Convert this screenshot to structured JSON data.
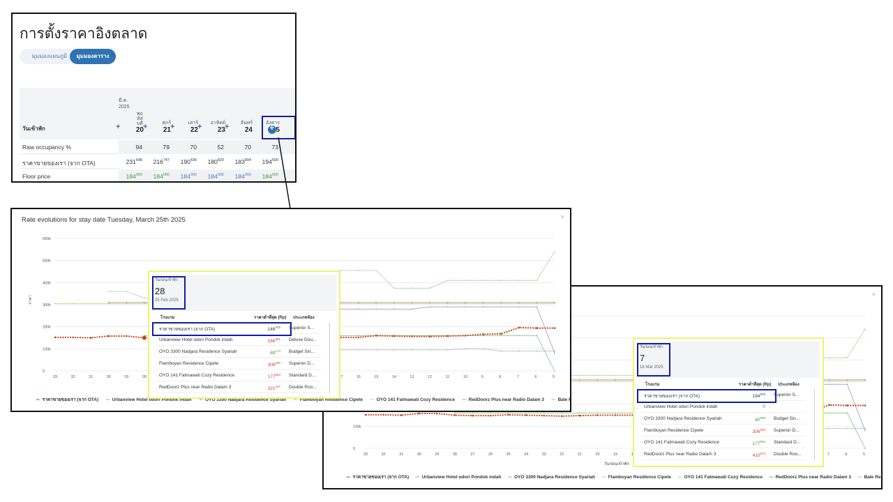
{
  "market": {
    "title": "การตั้งราคาอิงตลาด",
    "toggle_chart": "มุมมองแผนภูมิ",
    "toggle_table": "มุมมองตาราง",
    "month_label": "มี.ค.",
    "year_label": "2025",
    "row_header": "วันเข้าพัก",
    "days": [
      {
        "name": "พฤ หัส บดี",
        "num": "20"
      },
      {
        "name": "ศุกร์",
        "num": "21"
      },
      {
        "name": "เสาร์",
        "num": "22"
      },
      {
        "name": "อาทิตย์",
        "num": "23"
      },
      {
        "name": "จันทร์",
        "num": "24"
      },
      {
        "name": "อังคาร",
        "num": "25"
      }
    ],
    "rows": [
      {
        "label": "Raw occupancy %",
        "values": [
          {
            "m": "94",
            "s": ""
          },
          {
            "m": "79",
            "s": ""
          },
          {
            "m": "70",
            "s": ""
          },
          {
            "m": "52",
            "s": ""
          },
          {
            "m": "70",
            "s": ""
          },
          {
            "m": "73",
            "s": ""
          }
        ]
      },
      {
        "label": "ราคาขายของเรา (จาก OTA)",
        "values": [
          {
            "m": "231",
            "s": "648"
          },
          {
            "m": "216",
            "s": "747"
          },
          {
            "m": "190",
            "s": "436"
          },
          {
            "m": "180",
            "s": "820"
          },
          {
            "m": "183",
            "s": "804"
          },
          {
            "m": "194",
            "s": "509"
          }
        ]
      },
      {
        "label": "Floor price",
        "values": [
          {
            "m": "184",
            "s": "000"
          },
          {
            "m": "184",
            "s": "000"
          },
          {
            "m": "184",
            "s": "000"
          },
          {
            "m": "184",
            "s": "000"
          },
          {
            "m": "184",
            "s": "000"
          },
          {
            "m": "184",
            "s": "000"
          }
        ]
      }
    ],
    "floor_colors": [
      "#3a9b3a",
      "#3a9b3a",
      "#3d7fc2",
      "#3d7fc2",
      "#3d7fc2",
      "#3a9b3a"
    ]
  },
  "chart_panel": {
    "title": "Rate evolutions for stay date Tuesday, March 25th 2025",
    "close": "×",
    "y_axis_label": "ราคา",
    "x_axis_label": "วันก่อนเข้าพัก"
  },
  "chart_data": {
    "type": "line",
    "title": "Rate evolutions for stay date Tuesday, March 25th 2025",
    "xlabel": "วันก่อนเข้าพัก",
    "ylabel": "ราคา",
    "ylim": [
      0,
      600000
    ],
    "y_ticks": [
      "0",
      "100k",
      "200k",
      "300k",
      "400k",
      "500k",
      "600k"
    ],
    "x": [
      "33",
      "32",
      "31",
      "30",
      "29",
      "28",
      "27",
      "26",
      "25",
      "24",
      "23",
      "22",
      "21",
      "20",
      "19",
      "18",
      "17",
      "16",
      "15",
      "14",
      "13",
      "12",
      "11",
      "10",
      "9",
      "8",
      "7",
      "6",
      "5"
    ],
    "legend_position": "bottom",
    "series": [
      {
        "name": "ราคาขายของเรา (จาก OTA)",
        "color": "#c9461f",
        "values": [
          152000,
          152000,
          150000,
          158000,
          158000,
          150000,
          148000,
          148000,
          152000,
          150000,
          148000,
          146000,
          148000,
          150000,
          150000,
          150000,
          152000,
          152000,
          160000,
          158000,
          156000,
          156000,
          158000,
          160000,
          166000,
          168000,
          196000,
          194000,
          194000
        ]
      },
      {
        "name": "Urbanview Hotel odori Pondok indah",
        "color": "#7fc77f",
        "values": [
          null,
          null,
          null,
          null,
          null,
          160000,
          160000,
          160000,
          160000,
          160000,
          160000,
          160000,
          160000,
          160000,
          160000,
          160000,
          160000,
          160000,
          160000,
          160000,
          160000,
          160000,
          160000,
          160000,
          160000,
          160000,
          160000,
          160000,
          0
        ]
      },
      {
        "name": "OYO 3300 Nadjara Residence Syariah",
        "color": "#9a9ad8",
        "values": [
          null,
          null,
          null,
          null,
          null,
          null,
          null,
          null,
          null,
          null,
          null,
          null,
          null,
          null,
          null,
          null,
          280000,
          280000,
          280000,
          280000,
          280000,
          290000,
          290000,
          290000,
          290000,
          290000,
          290000,
          290000,
          80000
        ]
      },
      {
        "name": "Flamboyan Residence Cipete",
        "color": "#d6c27a",
        "values": [
          305000,
          305000,
          305000,
          305000,
          305000,
          305000,
          305000,
          305000,
          305000,
          305000,
          305000,
          305000,
          305000,
          305000,
          305000,
          305000,
          305000,
          305000,
          305000,
          305000,
          305000,
          305000,
          305000,
          305000,
          305000,
          305000,
          305000,
          305000,
          306000
        ]
      },
      {
        "name": "OYO 141 Fatmawati Cozy Residence",
        "color": "#a8d4a8",
        "values": [
          null,
          null,
          null,
          360000,
          360000,
          330000,
          330000,
          330000,
          330000,
          330000,
          330000,
          330000,
          330000,
          330000,
          330000,
          330000,
          455000,
          455000,
          455000,
          375000,
          375000,
          375000,
          410000,
          410000,
          410000,
          410000,
          410000,
          410000,
          540000
        ]
      },
      {
        "name": "RedDoorz Plus near Radio Dalam 3",
        "color": "#9a9a9a",
        "values": [
          null,
          null,
          null,
          310000,
          310000,
          310000,
          310000,
          310000,
          310000,
          310000,
          310000,
          310000,
          310000,
          310000,
          310000,
          310000,
          310000,
          310000,
          310000,
          310000,
          310000,
          310000,
          310000,
          310000,
          310000,
          310000,
          310000,
          310000,
          310000
        ]
      },
      {
        "name": "Bale Resident",
        "color": "#b5b5b5",
        "values": [
          null,
          null,
          null,
          null,
          null,
          null,
          null,
          null,
          null,
          null,
          null,
          null,
          null,
          null,
          null,
          null,
          95000,
          95000,
          95000,
          95000,
          95000,
          95000,
          95000,
          100000,
          100000,
          90000,
          90000,
          90000,
          90000
        ]
      }
    ]
  },
  "tooltip_a": {
    "k1": "วันก่อนเข้าพัก",
    "days_before": "28",
    "date": "25 Feb 2025",
    "col_hotel": "โรงแรม",
    "col_price": "ราคาต่ำที่สุด (Rp)",
    "col_room": "ประเภทห้อง",
    "rows": [
      {
        "name": "ราคาขายของเรา (จาก OTA)",
        "m": "146",
        "s": "472",
        "room": "Superior S...",
        "cls": ""
      },
      {
        "name": "Urbanview Hotel odori Pondok indah",
        "m": "166",
        "s": "381",
        "room": "Deluxe Dou...",
        "cls": "red"
      },
      {
        "name": "OYO 3300 Nadjara Residence Syariah",
        "m": "89",
        "s": "174",
        "room": "Budget Sin...",
        "cls": "grn"
      },
      {
        "name": "Flamboyan Residence Cipete",
        "m": "306",
        "s": "000",
        "room": "Superior D...",
        "cls": "red"
      },
      {
        "name": "OYO 141 Fatmawati Cozy Residence",
        "m": "177",
        "s": "064",
        "room": "Standard D...",
        "cls": "red"
      },
      {
        "name": "RedDoorz Plus near Radio Dalam 3",
        "m": "321",
        "s": "167",
        "room": "Double Roo...",
        "cls": "red"
      }
    ]
  },
  "tooltip_b": {
    "k1": "วันก่อนเข้าพัก",
    "days_before": "7",
    "date": "18 Mar 2025",
    "col_hotel": "โรงแรม",
    "col_price": "ราคาต่ำที่สุด (Rp)",
    "col_room": "ประเภทห้อง",
    "rows": [
      {
        "name": "ราคาขายของเรา (จาก OTA)",
        "m": "194",
        "s": "875",
        "room": "Superior S...",
        "cls": ""
      },
      {
        "name": "Urbanview Hotel odori Pondok indah",
        "m": "0",
        "s": "",
        "room": "",
        "cls": "grn"
      },
      {
        "name": "OYO 3300 Nadjara Residence Syariah",
        "m": "80",
        "s": "865",
        "room": "Budget Sin...",
        "cls": "grn"
      },
      {
        "name": "Flamboyan Residence Cipete",
        "m": "306",
        "s": "000",
        "room": "Superior D...",
        "cls": "red"
      },
      {
        "name": "OYO 141 Fatmawati Cozy Residence",
        "m": "177",
        "s": "064",
        "room": "Standard D...",
        "cls": "grn"
      },
      {
        "name": "RedDoorz Plus near Radio Dalam 3",
        "m": "410",
        "s": "673",
        "room": "Double Roo...",
        "cls": "red"
      }
    ]
  }
}
